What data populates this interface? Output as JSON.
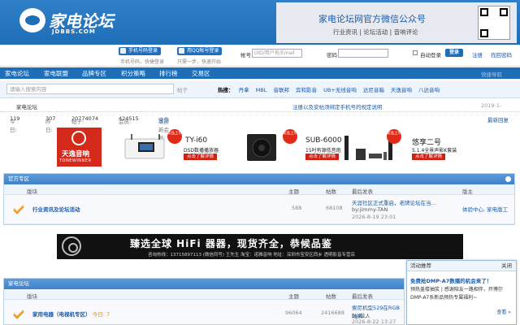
{
  "header": {
    "logo_text": "家电论坛",
    "logo_domain": "JDBBS.COM",
    "wechat_title": "家电论坛网官方微信公众号",
    "wechat_sub": "行业资讯 | 论坛活动 | 音响评论"
  },
  "login": {
    "mobile_btn": "手机号码登录",
    "mobile_sub": "手机号码，快捷登录",
    "qq_btn": "用QQ帐号登录",
    "qq_sub": "只需一步，快速开始",
    "account_label": "帐号",
    "account_placeholder": "UID/用户名/Email",
    "password_label": "密码",
    "auto_login": "自动登录",
    "login_btn": "登录",
    "register": "注册",
    "forgot": "找回密码"
  },
  "nav": {
    "items": [
      "家电论坛",
      "家电联盟",
      "品牌专区",
      "积分策略",
      "排行榜",
      "交易区"
    ],
    "right": "快捷导航"
  },
  "search": {
    "placeholder": "请输入搜索内容",
    "type": "帖子",
    "hot_label": "热搜：",
    "hot": [
      "丹拿",
      "MBL",
      "音联邦",
      "弈和影音",
      "UB+无线音响",
      "达尼音箱",
      "天逸音响",
      "八达音响"
    ]
  },
  "crumb": {
    "home": "家电论坛",
    "notice": "注册以及安帖须绑定手机号的规定说明",
    "date": "2019-1-"
  },
  "stats": {
    "today_label": "今日:",
    "today": "119",
    "yesterday_label": "昨日:",
    "yesterday": "307",
    "posts_label": "帖子:",
    "posts": "20774074",
    "members_label": "会员:",
    "members": "424515",
    "welcome_label": "欢迎新会员:",
    "newest": "宝鼎",
    "latest_reply": "最新回复"
  },
  "strip": {
    "brand_cn": "天逸音响",
    "brand_en": "TONEWINNER",
    "products": [
      {
        "name": "TY-i60",
        "desc": "DSD数播播放器",
        "go": "点击了解详情",
        "badge": "新品上市"
      },
      {
        "name": "SUB-6000",
        "desc": "15吋有源低音炮",
        "go": "点击了解详情",
        "badge": "新品上市"
      },
      {
        "name": "悠享二号",
        "desc": "5.1.4全景声影K套装",
        "go": "点击了解详情",
        "badge": "新品上市"
      }
    ]
  },
  "cat1": {
    "title": "官方专区",
    "cols": {
      "forum": "版块",
      "topics": "主题",
      "posts": "帖数",
      "last": "最后发表",
      "mod": "版主"
    },
    "row": {
      "name": "行业资讯及论坛活动",
      "topics": "588",
      "posts": "68108",
      "last_title": "天涯社区正式重启，老牌论坛在当…",
      "last_by": "by:jimmy-TAN",
      "last_time": "2026-8-19 23:01",
      "mod": "体验中心, 家电版工"
    }
  },
  "ad": {
    "title": "臻选全球 HiFi 器器，现货齐全，恭候品鉴",
    "sub": "咨询热线：13715897113 (微信同号) 王先生    淘宝：诺雅音响    地址：深圳市宝安区西乡 透明影音专营店"
  },
  "cat2": {
    "title": "家电论坛",
    "cols": {
      "forum": "版块",
      "topics": "主题",
      "posts": "帖数",
      "last": "最后发表",
      "mod": "版主"
    },
    "row": {
      "name": "家用电器（电视机专区）",
      "today": "今日: 7",
      "topics": "96064",
      "posts": "2416688",
      "last_title": "索尼机型529在RGB效果…",
      "last_by": "by:单人",
      "last_time": "2026-8-22 13:27"
    }
  },
  "popup": {
    "title": "活动推荐",
    "close": "关闭",
    "headline": "免费抢DMP-A7数播的机会来了！",
    "body": "预热盖楼抽奖 | 感谢陪友一路相伴，开博尔DMP-A7系新品预热专属福利~",
    "more": "查看 »"
  }
}
